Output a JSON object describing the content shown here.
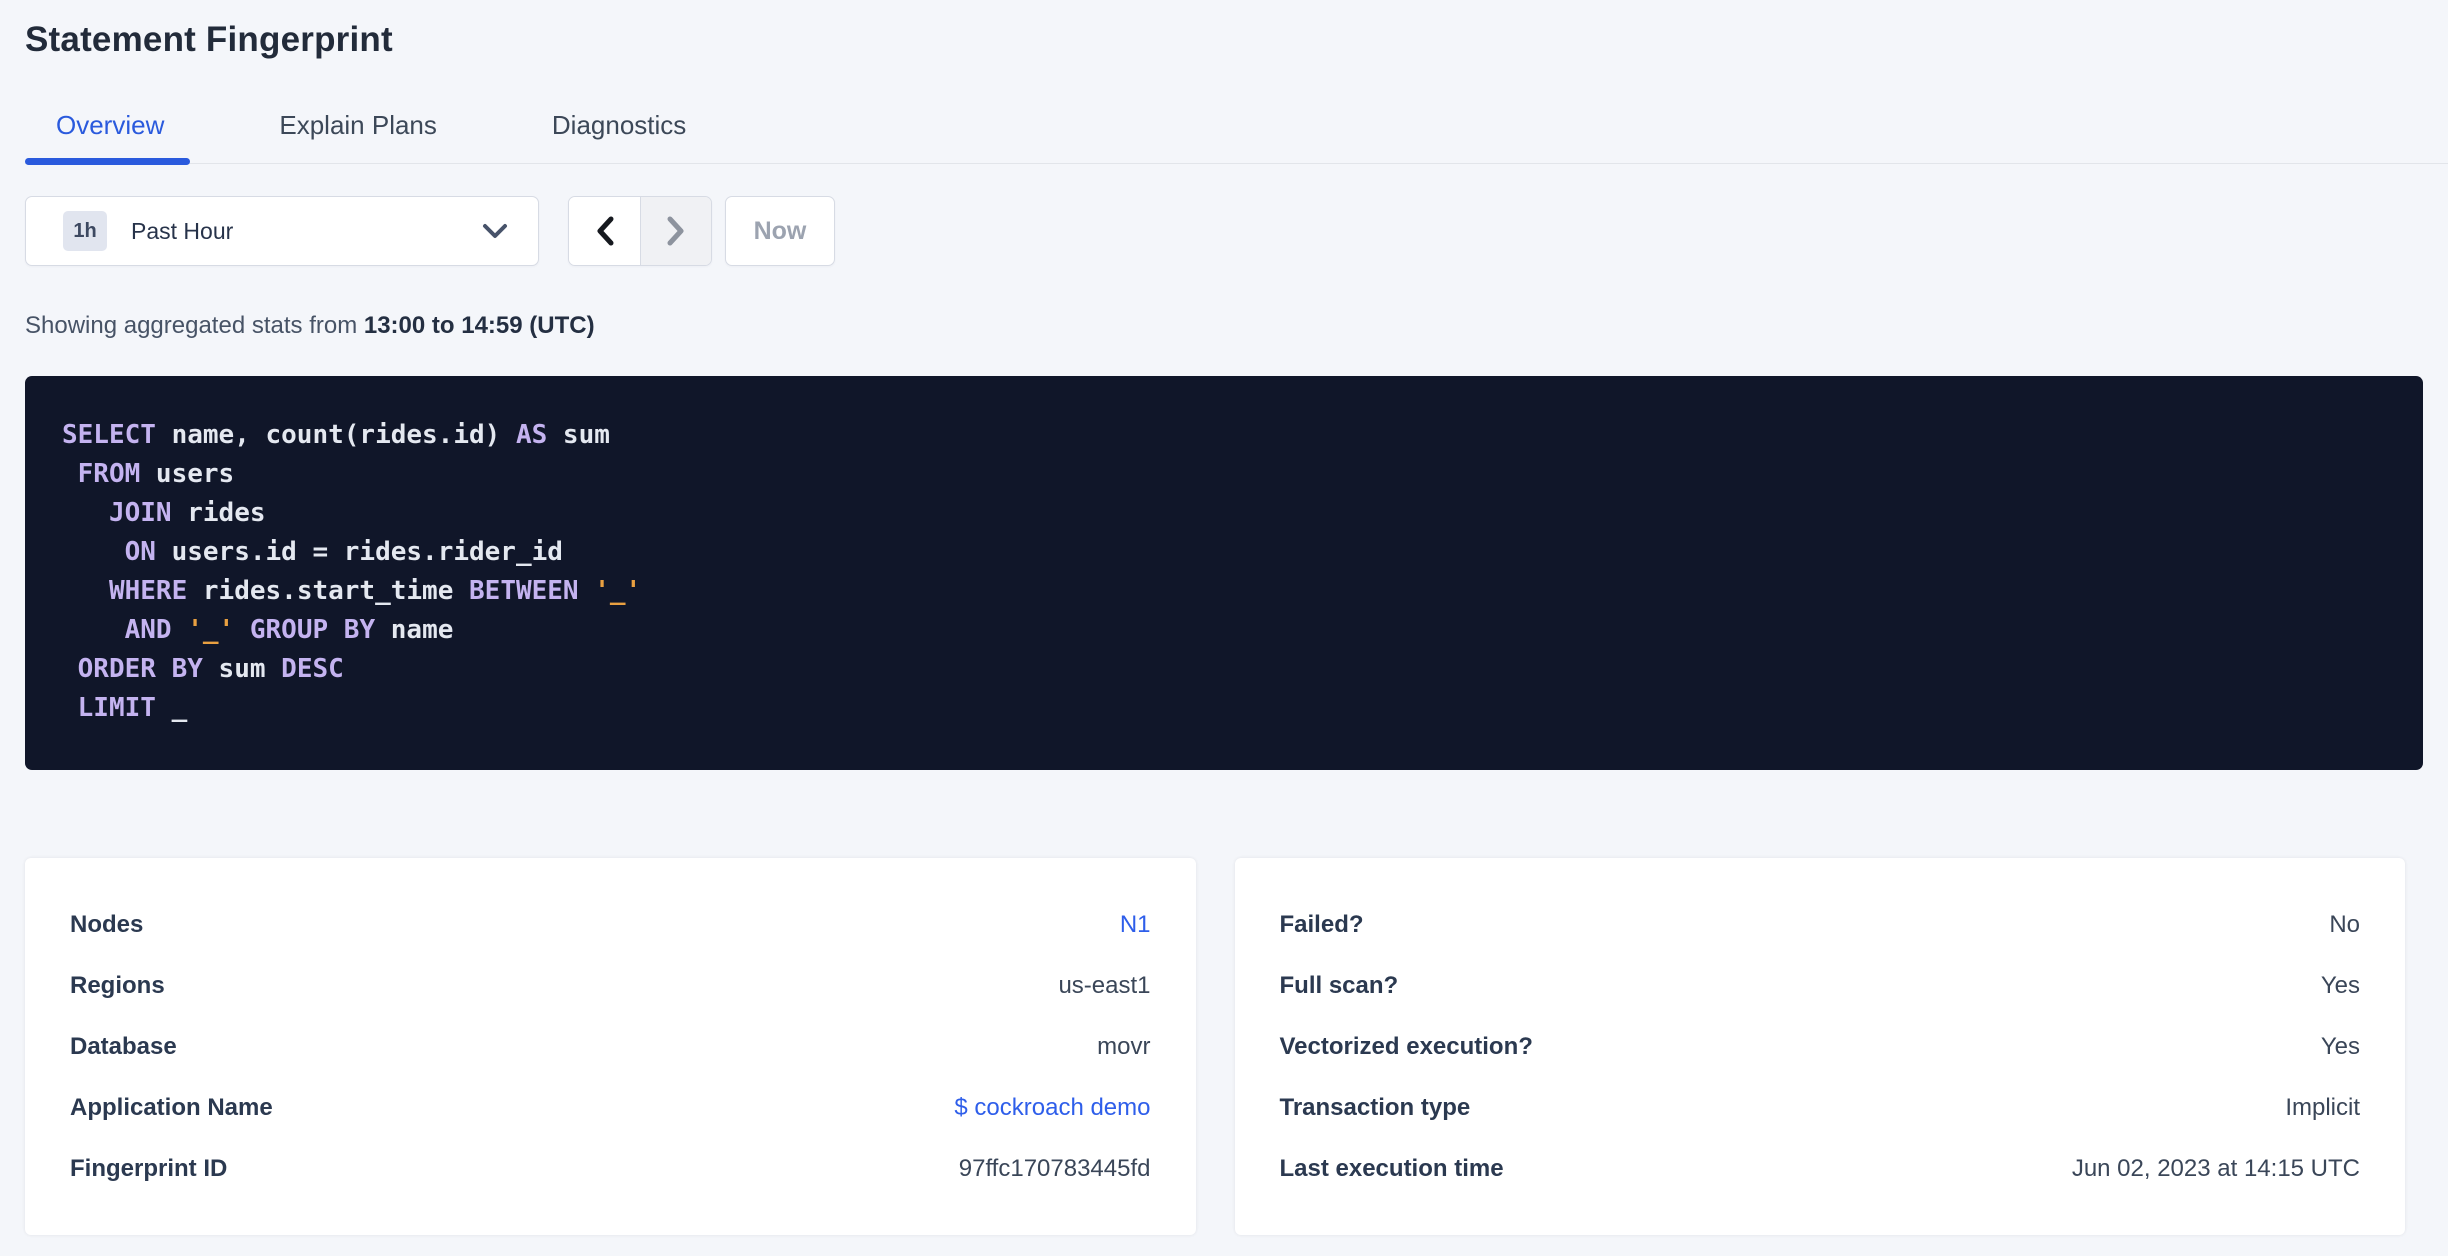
{
  "colors": {
    "accent_blue": "#2a5add",
    "link_blue": "#2e5eea",
    "page_background": "#f4f6fa",
    "code_background": "#101629",
    "code_keyword": "#c4b3f0",
    "code_text": "#e4e8f0",
    "code_literal": "#e9a041"
  },
  "header": {
    "title": "Statement Fingerprint"
  },
  "tabs": [
    {
      "label": "Overview",
      "active": true
    },
    {
      "label": "Explain Plans",
      "active": false
    },
    {
      "label": "Diagnostics",
      "active": false
    }
  ],
  "time_picker": {
    "badge": "1h",
    "selected_label": "Past Hour",
    "prev_enabled": true,
    "next_enabled": false,
    "now_label": "Now"
  },
  "stats_line": {
    "prefix": "Showing aggregated stats from ",
    "range": "13:00 to 14:59 (UTC)"
  },
  "sql": {
    "lines": [
      [
        {
          "t": "SELECT",
          "c": "k"
        },
        {
          "t": " name, count(rides.id) ",
          "c": "p"
        },
        {
          "t": "AS",
          "c": "k"
        },
        {
          "t": " sum",
          "c": "p"
        }
      ],
      [
        {
          "t": " ",
          "c": "p"
        },
        {
          "t": "FROM",
          "c": "k"
        },
        {
          "t": " users",
          "c": "p"
        }
      ],
      [
        {
          "t": "   ",
          "c": "p"
        },
        {
          "t": "JOIN",
          "c": "k"
        },
        {
          "t": " rides",
          "c": "p"
        }
      ],
      [
        {
          "t": "    ",
          "c": "p"
        },
        {
          "t": "ON",
          "c": "k"
        },
        {
          "t": " users.id = rides.rider_id",
          "c": "p"
        }
      ],
      [
        {
          "t": "   ",
          "c": "p"
        },
        {
          "t": "WHERE",
          "c": "k"
        },
        {
          "t": " rides.start_time ",
          "c": "p"
        },
        {
          "t": "BETWEEN",
          "c": "k"
        },
        {
          "t": " ",
          "c": "p"
        },
        {
          "t": "'_'",
          "c": "l"
        }
      ],
      [
        {
          "t": "    ",
          "c": "p"
        },
        {
          "t": "AND",
          "c": "k"
        },
        {
          "t": " ",
          "c": "p"
        },
        {
          "t": "'_'",
          "c": "l"
        },
        {
          "t": " ",
          "c": "p"
        },
        {
          "t": "GROUP BY",
          "c": "k"
        },
        {
          "t": " name",
          "c": "p"
        }
      ],
      [
        {
          "t": " ",
          "c": "p"
        },
        {
          "t": "ORDER BY",
          "c": "k"
        },
        {
          "t": " sum ",
          "c": "p"
        },
        {
          "t": "DESC",
          "c": "k"
        }
      ],
      [
        {
          "t": " ",
          "c": "p"
        },
        {
          "t": "LIMIT",
          "c": "k"
        },
        {
          "t": " _",
          "c": "p"
        }
      ]
    ]
  },
  "cards": {
    "left": {
      "rows": [
        {
          "label": "Nodes",
          "value": "N1",
          "link": true
        },
        {
          "label": "Regions",
          "value": "us-east1",
          "link": false
        },
        {
          "label": "Database",
          "value": "movr",
          "link": false
        },
        {
          "label": "Application Name",
          "value": "$ cockroach demo",
          "link": true
        },
        {
          "label": "Fingerprint ID",
          "value": "97ffc170783445fd",
          "link": false
        }
      ]
    },
    "right": {
      "rows": [
        {
          "label": "Failed?",
          "value": "No",
          "link": false
        },
        {
          "label": "Full scan?",
          "value": "Yes",
          "link": false
        },
        {
          "label": "Vectorized execution?",
          "value": "Yes",
          "link": false
        },
        {
          "label": "Transaction type",
          "value": "Implicit",
          "link": false
        },
        {
          "label": "Last execution time",
          "value": "Jun 02, 2023 at 14:15 UTC",
          "link": false
        }
      ]
    }
  }
}
